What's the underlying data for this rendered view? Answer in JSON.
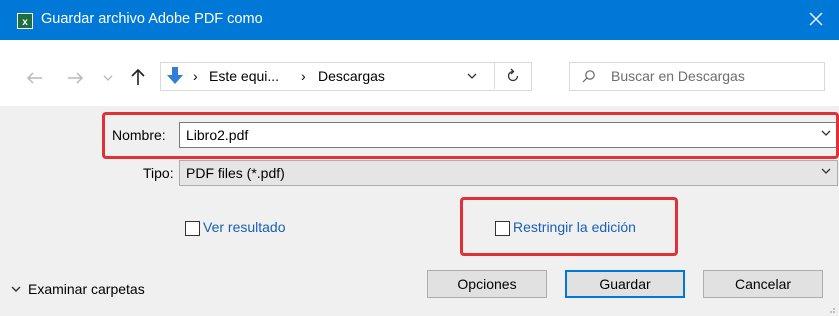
{
  "window": {
    "title": "Guardar archivo Adobe PDF como",
    "app_icon": "excel-icon",
    "accent": "#0078d7"
  },
  "nav": {
    "back_icon": "arrow-left-icon",
    "forward_icon": "arrow-right-icon",
    "recent_icon": "chevron-down-icon",
    "up_icon": "arrow-up-icon",
    "path": [
      "Este equi...",
      "Descargas"
    ],
    "refresh_icon": "refresh-icon",
    "search_placeholder": "Buscar en Descargas"
  },
  "form": {
    "name_label": "Nombre:",
    "name_value": "Libro2.pdf",
    "type_label": "Tipo:",
    "type_value": "PDF files (*.pdf)"
  },
  "options": {
    "view_result_label": "Ver resultado",
    "view_result_checked": false,
    "restrict_edit_label": "Restringir la edición",
    "restrict_edit_checked": false
  },
  "footer": {
    "browse_label": "Examinar carpetas",
    "options_button": "Opciones",
    "save_button": "Guardar",
    "cancel_button": "Cancelar"
  },
  "highlight_color": "#e03138"
}
